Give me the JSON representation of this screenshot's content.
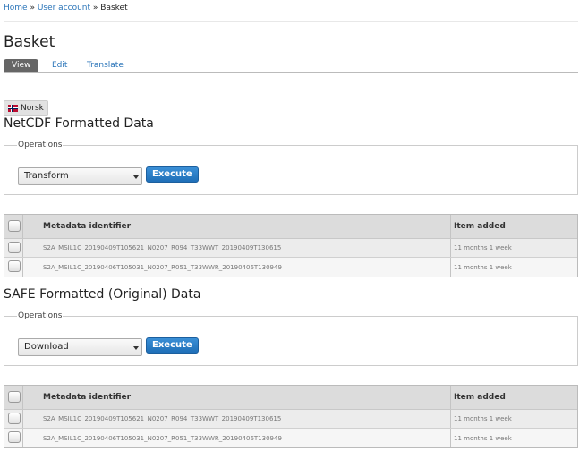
{
  "breadcrumb": {
    "home": "Home",
    "sep1": " » ",
    "account": "User account",
    "sep2": " » ",
    "current": "Basket"
  },
  "page_title": "Basket",
  "tabs": {
    "view": "View",
    "edit": "Edit",
    "translate": "Translate"
  },
  "language_button": "Norsk",
  "sections": [
    {
      "title": "NetCDF Formatted Data",
      "operations_legend": "Operations",
      "selected_operation": "Transform",
      "execute_label": "Execute",
      "columns": {
        "identifier": "Metadata identifier",
        "added": "Item added"
      },
      "rows": [
        {
          "identifier": "S2A_MSIL1C_20190409T105621_N0207_R094_T33WWT_20190409T130615",
          "added": "11 months 1 week"
        },
        {
          "identifier": "S2A_MSIL1C_20190406T105031_N0207_R051_T33WWR_20190406T130949",
          "added": "11 months 1 week"
        }
      ]
    },
    {
      "title": "SAFE Formatted (Original) Data",
      "operations_legend": "Operations",
      "selected_operation": "Download",
      "execute_label": "Execute",
      "columns": {
        "identifier": "Metadata identifier",
        "added": "Item added"
      },
      "rows": [
        {
          "identifier": "S2A_MSIL1C_20190409T105621_N0207_R094_T33WWT_20190409T130615",
          "added": "11 months 1 week"
        },
        {
          "identifier": "S2A_MSIL1C_20190406T105031_N0207_R051_T33WWR_20190406T130949",
          "added": "11 months 1 week"
        }
      ]
    }
  ],
  "colors": {
    "link": "#2873b8",
    "execute_button": "#2a7fc9",
    "active_tab": "#666666"
  },
  "icons": {
    "language_flag": "norway-flag-icon",
    "select_caret": "caret-down-icon"
  }
}
